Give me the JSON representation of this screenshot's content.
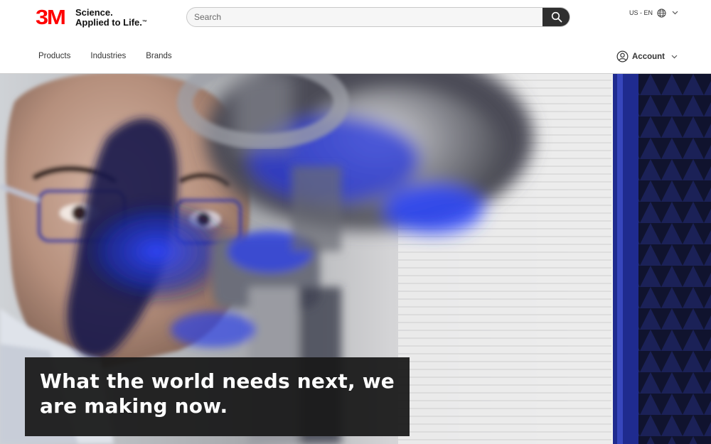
{
  "brand": {
    "logo_text": "3M",
    "tagline_line1": "Science.",
    "tagline_line2": "Applied to Life.",
    "trademark": "™",
    "logo_color": "#ff0000"
  },
  "search": {
    "placeholder": "Search",
    "value": "",
    "button_icon": "magnifier-icon"
  },
  "locale": {
    "label": "US - EN",
    "icon": "globe-icon"
  },
  "nav": {
    "items": [
      {
        "label": "Products"
      },
      {
        "label": "Industries"
      },
      {
        "label": "Brands"
      }
    ]
  },
  "account": {
    "label": "Account",
    "icon": "user-circle-icon"
  },
  "hero": {
    "headline": "What the world needs next, we are making now.",
    "caption_background": "#1a1a1a",
    "accent_light": "#2a3fd6"
  }
}
